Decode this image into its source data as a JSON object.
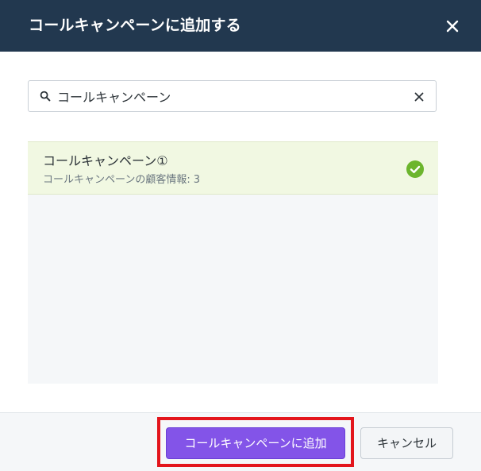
{
  "dialog": {
    "title": "コールキャンペーンに追加する",
    "close_icon": "close-icon"
  },
  "search": {
    "value": "コールキャンペーン",
    "placeholder": "",
    "search_icon": "search-icon",
    "clear_icon": "clear-icon"
  },
  "results": {
    "items": [
      {
        "title": "コールキャンペーン①",
        "subtitle": "コールキャンペーンの顧客情報:",
        "count": "3",
        "selected": true,
        "check_icon": "check-circle-icon"
      }
    ]
  },
  "footer": {
    "add_label": "コールキャンペーンに追加",
    "cancel_label": "キャンセル"
  },
  "colors": {
    "header_bg": "#22384f",
    "primary": "#8354e8",
    "selected_bg": "#f1f8e2",
    "check": "#6cb52d",
    "highlight": "#e3151c"
  }
}
